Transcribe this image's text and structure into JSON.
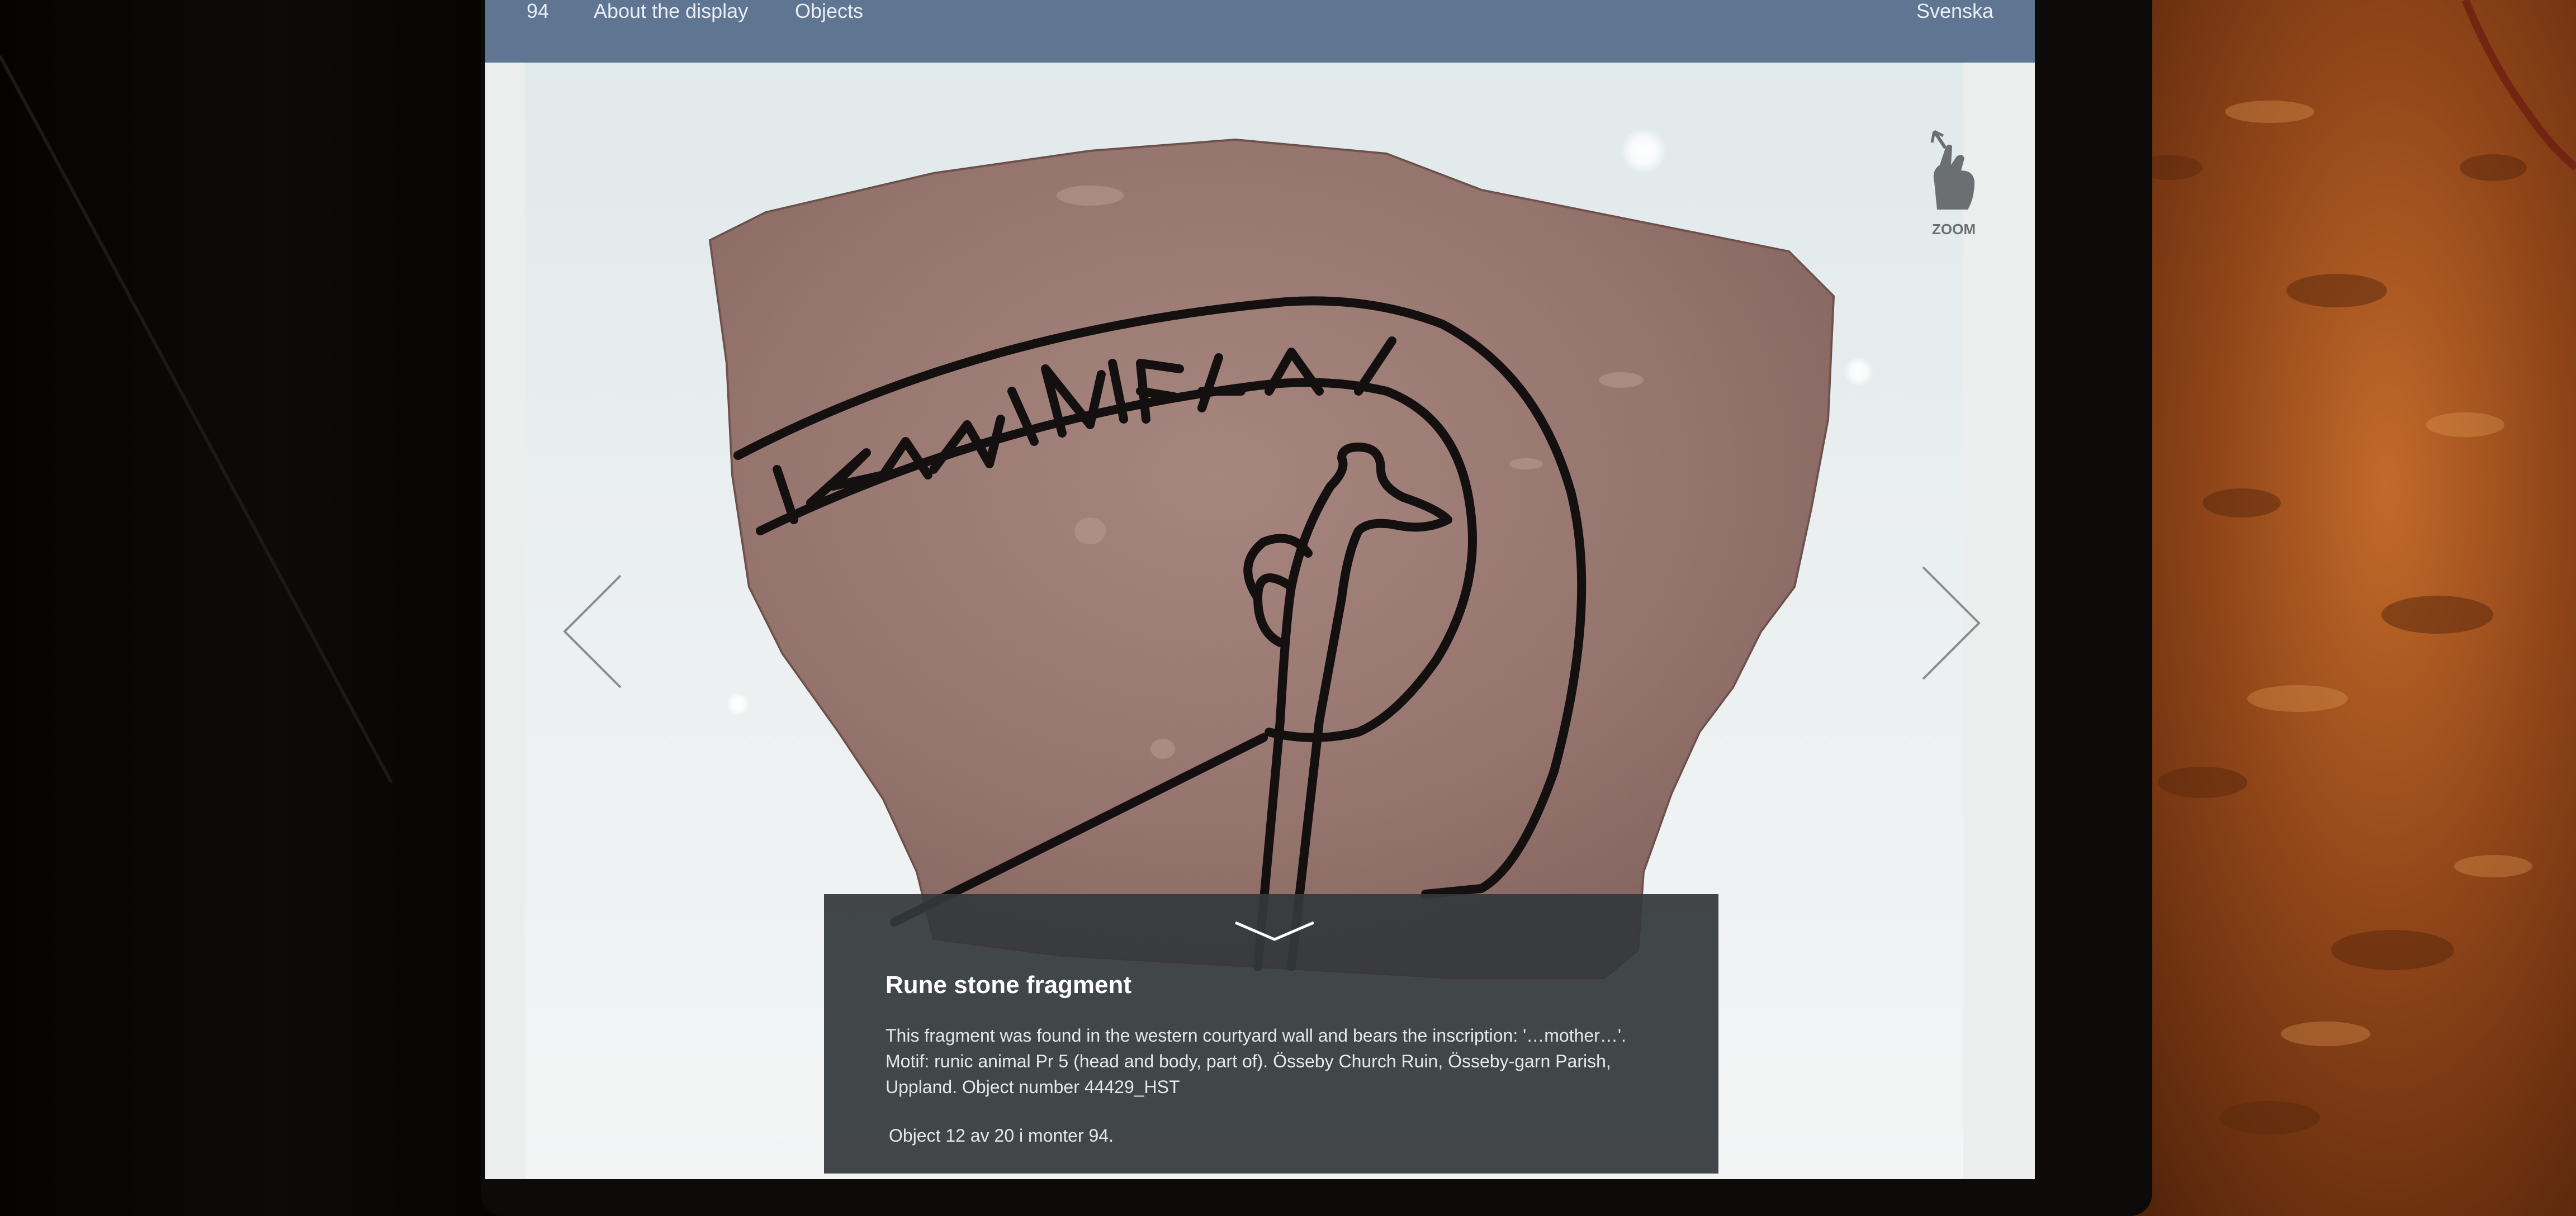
{
  "nav": {
    "monitor_number": "94",
    "about_label": "About the display",
    "objects_label": "Objects",
    "language_label": "Svenska"
  },
  "zoom": {
    "label": "ZOOM",
    "icon": "hand-pinch-zoom-icon"
  },
  "navigation": {
    "prev_icon": "chevron-left-icon",
    "next_icon": "chevron-right-icon"
  },
  "info": {
    "collapse_icon": "chevron-down-icon",
    "title": "Rune stone fragment",
    "description_line1": "This fragment was found in the western courtyard wall and bears the inscription: '…mother…'.",
    "description_line2": "Motif: runic animal Pr 5 (head and body, part of). Össeby Church Ruin, Össeby-garn Parish,",
    "description_line3": "Uppland. Object number 44429_HST",
    "counter": "Object 12 av 20 i monter 94."
  },
  "colors": {
    "navbar": "#5f7591",
    "panel": "#34383a",
    "stone": "#9a7670",
    "inscription": "#141010"
  }
}
